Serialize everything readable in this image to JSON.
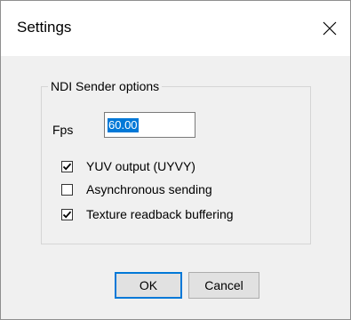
{
  "window": {
    "title": "Settings"
  },
  "icons": {
    "close": "close-icon",
    "checkmark": "checkmark-icon"
  },
  "group": {
    "legend": "NDI Sender options",
    "fps": {
      "label": "Fps",
      "value": "60.00"
    },
    "options": [
      {
        "label": "YUV output (UYVY)",
        "checked": true
      },
      {
        "label": "Asynchronous sending",
        "checked": false
      },
      {
        "label": "Texture readback buffering",
        "checked": true
      }
    ]
  },
  "buttons": {
    "ok": "OK",
    "cancel": "Cancel"
  },
  "colors": {
    "dialog_bg": "#f0f0f0",
    "titlebar_bg": "#ffffff",
    "selection": "#0078d7",
    "button_bg": "#e1e1e1",
    "default_button_border": "#0078d7"
  }
}
